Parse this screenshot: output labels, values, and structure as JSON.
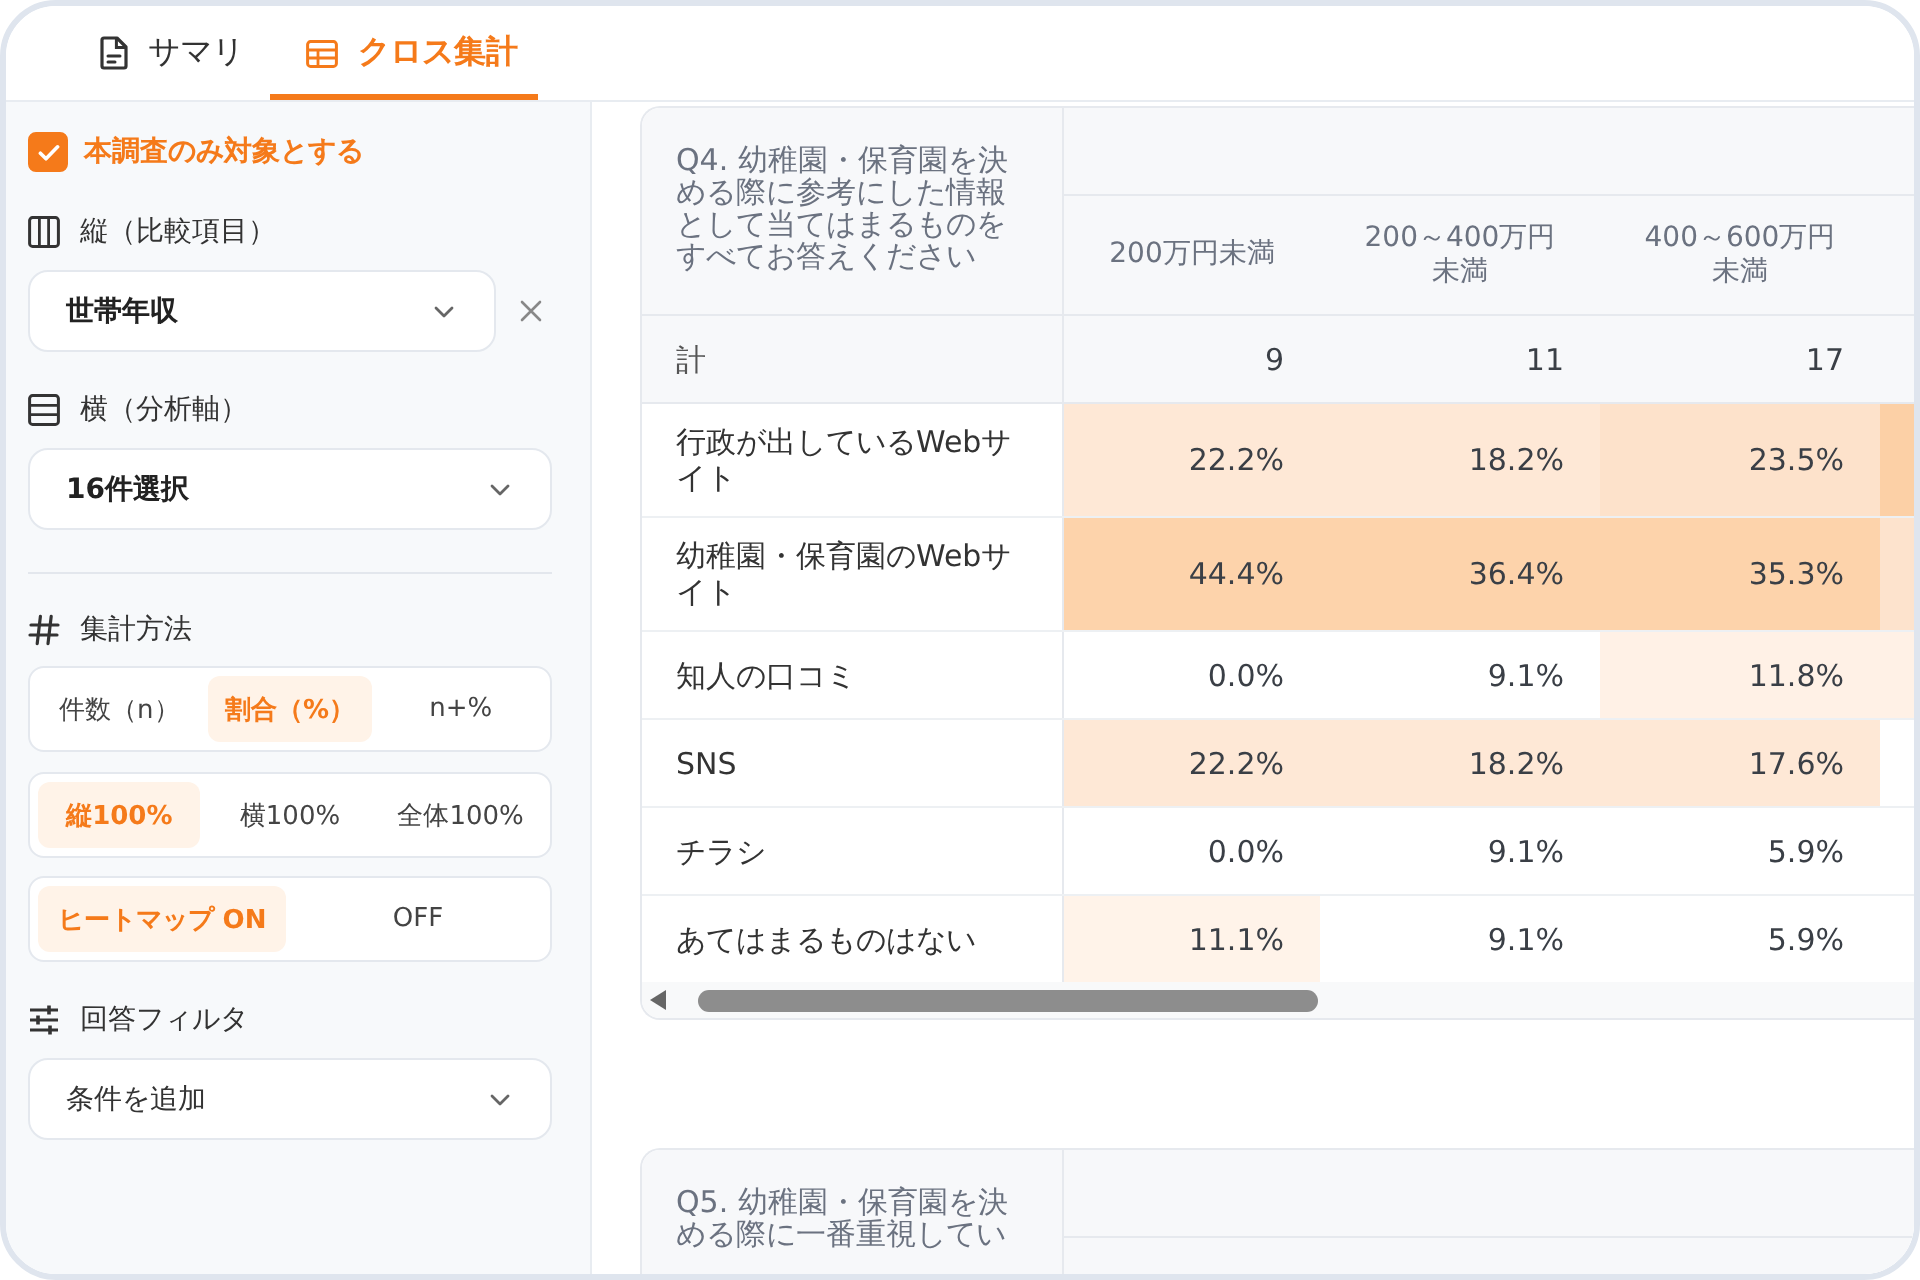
{
  "tabs": [
    {
      "kind": "summary",
      "label": "サマリ",
      "selected": false
    },
    {
      "kind": "crosstab",
      "label": "クロス集計",
      "selected": true
    }
  ],
  "sidebar": {
    "scope": {
      "label": "本調査のみ対象とする",
      "checked": true
    },
    "axes": [
      {
        "kind": "columns",
        "title": "縦（比較項目）",
        "select": {
          "value": "世帯年収",
          "clearable": true
        }
      },
      {
        "kind": "rows",
        "title": "横（分析軸）",
        "select": {
          "value": "16件選択",
          "clearable": false
        }
      }
    ],
    "method": {
      "title": "集計方法",
      "groups": [
        [
          {
            "label": "件数（n）",
            "selected": false
          },
          {
            "label": "割合（%）",
            "selected": true
          },
          {
            "label": "n+%",
            "selected": false
          }
        ],
        [
          {
            "label": "縦100%",
            "selected": true
          },
          {
            "label": "横100%",
            "selected": false
          },
          {
            "label": "全体100%",
            "selected": false
          }
        ],
        [
          {
            "label": "ヒートマップ ON",
            "selected": true
          },
          {
            "label": "OFF",
            "selected": false
          }
        ]
      ]
    },
    "filter": {
      "title": "回答フィルタ",
      "select": {
        "placeholder": "条件を追加"
      }
    }
  },
  "tables": [
    {
      "question": "Q4. 幼稚園・保育園を決める際に参考にした情報として当てはまるものをすべてお答えください",
      "columns": [
        "200万円未満",
        "200～400万円未満",
        "400～600万円未満"
      ],
      "total": {
        "label": "計",
        "values": [
          "9",
          "11",
          "17"
        ]
      },
      "rows": [
        {
          "label": "行政が出しているWebサイト",
          "cells": [
            {
              "value": "22.2%",
              "color": "#fee8d6"
            },
            {
              "value": "18.2%",
              "color": "#fee8d6"
            },
            {
              "value": "23.5%",
              "color": "#fde2cb"
            },
            {
              "color": "#fcd0a6"
            }
          ]
        },
        {
          "label": "幼稚園・保育園のWebサイト",
          "cells": [
            {
              "value": "44.4%",
              "color": "#fdd3ab"
            },
            {
              "value": "36.4%",
              "color": "#fdd3ab"
            },
            {
              "value": "35.3%",
              "color": "#fdd3ab"
            },
            {
              "color": "#fde3cd"
            }
          ]
        },
        {
          "label": "知人の口コミ",
          "cells": [
            {
              "value": "0.0%"
            },
            {
              "value": "9.1%"
            },
            {
              "value": "11.8%",
              "color": "#fff1e6"
            },
            {
              "color": "#fff1e6"
            }
          ]
        },
        {
          "label": "SNS",
          "cells": [
            {
              "value": "22.2%",
              "color": "#fee8d6"
            },
            {
              "value": "18.2%",
              "color": "#fee8d6"
            },
            {
              "value": "17.6%",
              "color": "#fee8d6"
            }
          ]
        },
        {
          "label": "チラシ",
          "cells": [
            {
              "value": "0.0%"
            },
            {
              "value": "9.1%"
            },
            {
              "value": "5.9%"
            }
          ]
        },
        {
          "label": "あてはまるものはない",
          "cells": [
            {
              "value": "11.1%",
              "color": "#fff3e9"
            },
            {
              "value": "9.1%"
            },
            {
              "value": "5.9%"
            }
          ]
        }
      ]
    },
    {
      "question": "Q5. 幼稚園・保育園を決める際に一番重視してい"
    }
  ]
}
